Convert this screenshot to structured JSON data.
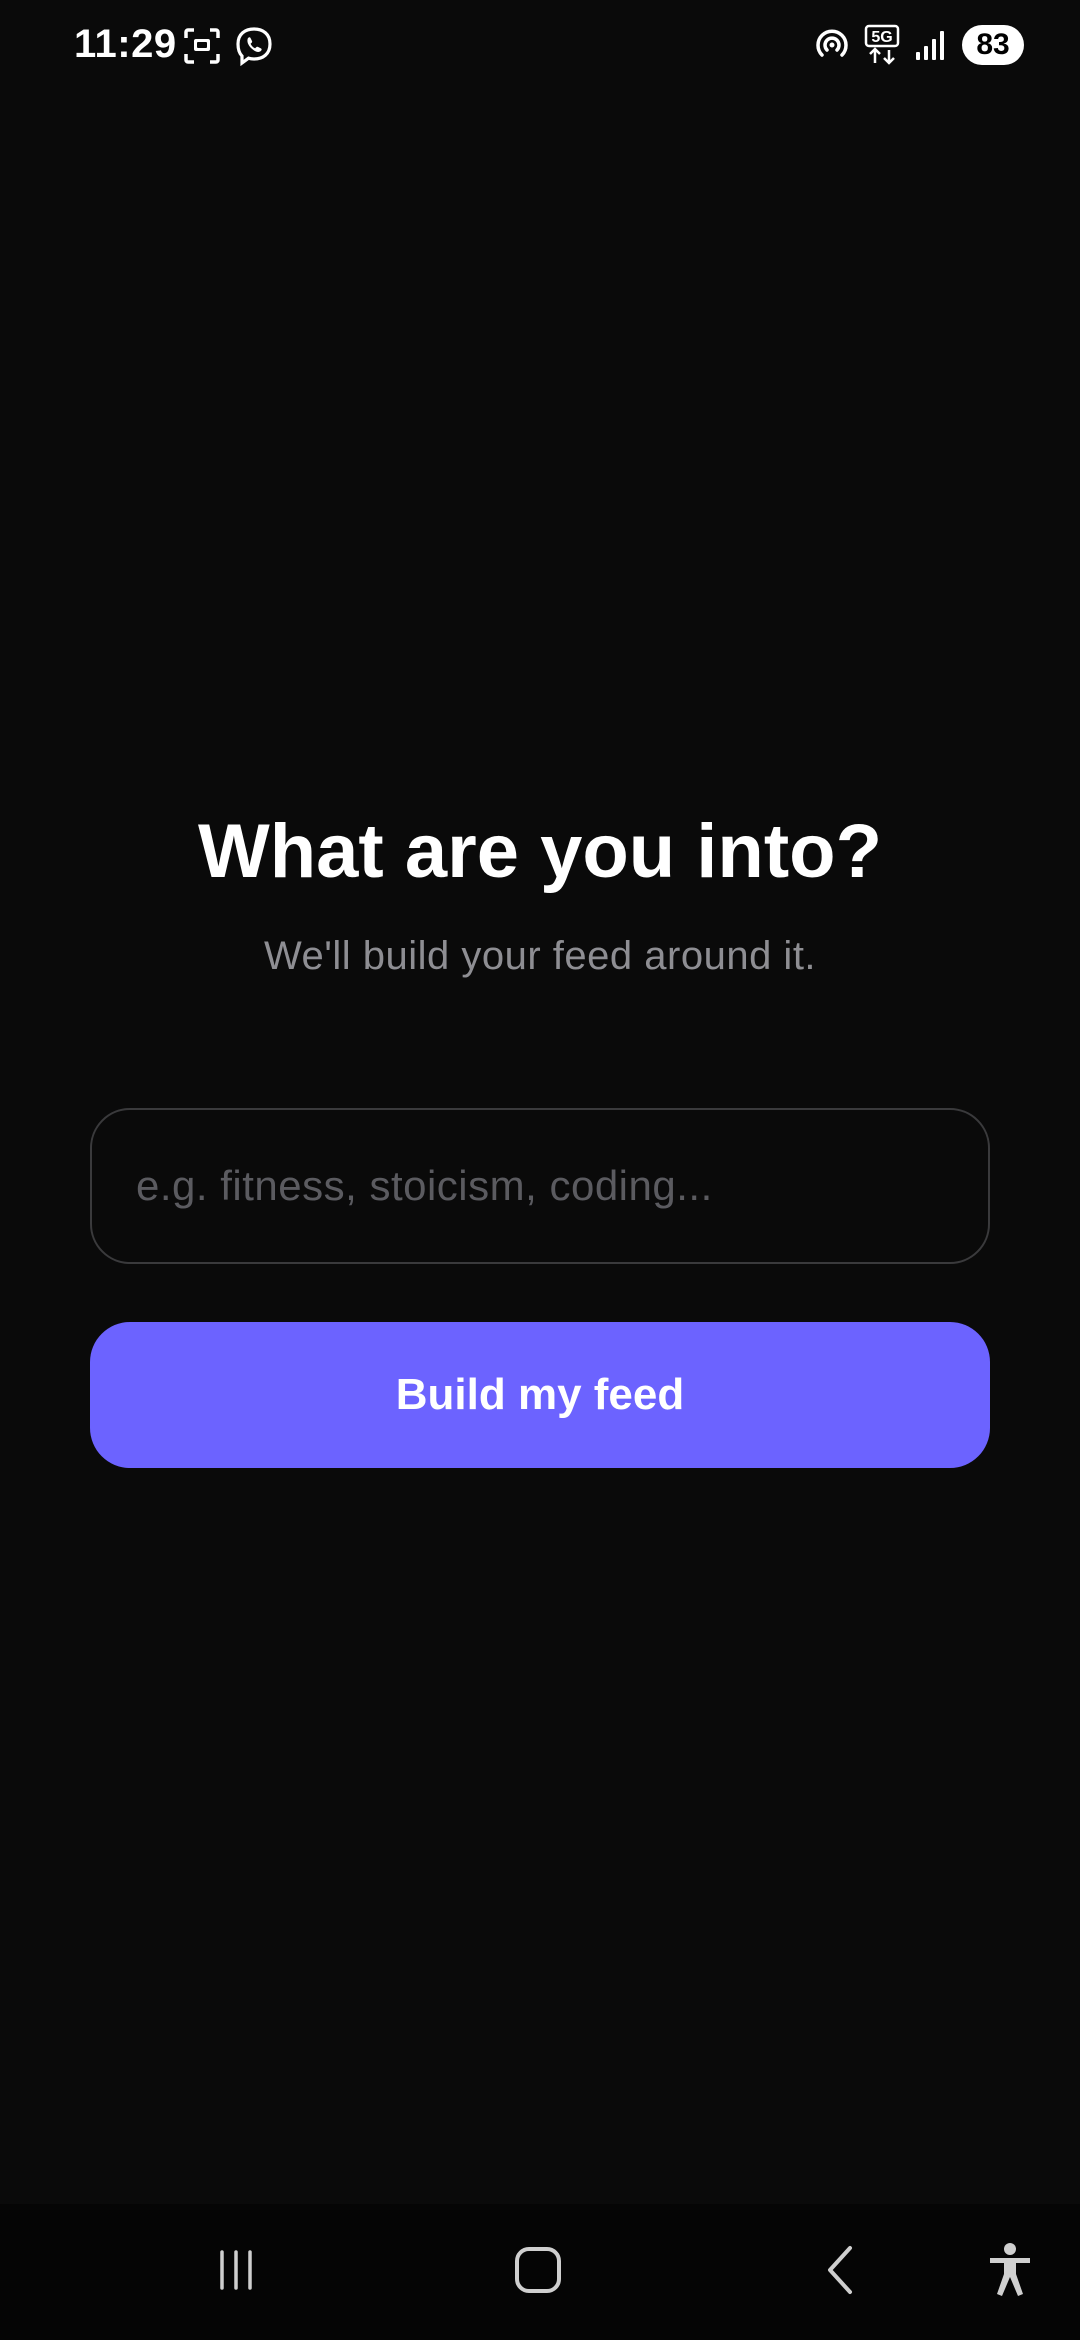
{
  "status_bar": {
    "time": "11:29",
    "left_icons": [
      "screenshot-icon",
      "viber-icon"
    ],
    "right_icons": [
      "hotspot-icon",
      "5g-data-icon",
      "signal-icon"
    ],
    "network_label": "5G",
    "battery_level": "83"
  },
  "main": {
    "title": "What are you into?",
    "subtitle": "We'll build your feed around it.",
    "input": {
      "value": "",
      "placeholder": "e.g. fitness, stoicism, coding..."
    },
    "submit_label": "Build my feed"
  },
  "nav_bar": {
    "buttons": [
      "recent-apps-icon",
      "home-icon",
      "back-icon",
      "accessibility-icon"
    ]
  },
  "colors": {
    "background": "#0a0a0a",
    "accent": "#6c63ff",
    "subtitle": "#8e8e93",
    "input_border": "#3a3a3c",
    "placeholder": "#5b5b60"
  }
}
